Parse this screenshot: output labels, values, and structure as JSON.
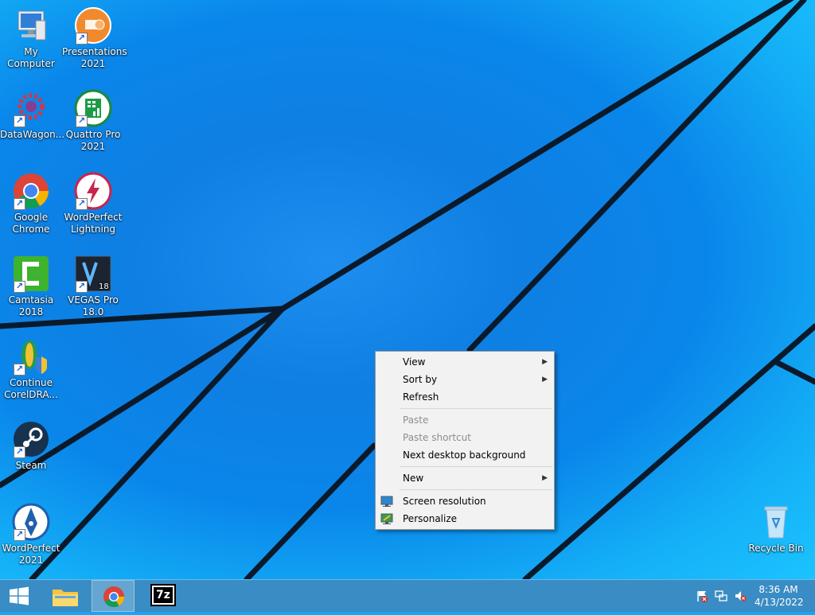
{
  "desktop": {
    "icons": [
      {
        "label": "My Computer",
        "icon": "computer-icon"
      },
      {
        "label": "Presentations 2021",
        "icon": "presentations-icon"
      },
      {
        "label": "DataWagon...",
        "icon": "datawagon-icon"
      },
      {
        "label": "Quattro Pro 2021",
        "icon": "quattro-pro-icon"
      },
      {
        "label": "Google Chrome",
        "icon": "chrome-icon"
      },
      {
        "label": "WordPerfect Lightning",
        "icon": "wordperfect-lightning-icon"
      },
      {
        "label": "Camtasia 2018",
        "icon": "camtasia-icon"
      },
      {
        "label": "VEGAS Pro 18.0",
        "icon": "vegas-pro-icon"
      },
      {
        "label": "Continue CorelDRA...",
        "icon": "coreldraw-icon"
      },
      {
        "label": "Steam",
        "icon": "steam-icon"
      },
      {
        "label": "WordPerfect 2021",
        "icon": "wordperfect-icon"
      },
      {
        "label": "Recycle Bin",
        "icon": "recycle-bin-icon"
      }
    ]
  },
  "context_menu": {
    "items": [
      {
        "label": "View",
        "submenu": true,
        "enabled": true
      },
      {
        "label": "Sort by",
        "submenu": true,
        "enabled": true
      },
      {
        "label": "Refresh",
        "submenu": false,
        "enabled": true
      },
      {
        "label": "Paste",
        "submenu": false,
        "enabled": false
      },
      {
        "label": "Paste shortcut",
        "submenu": false,
        "enabled": false
      },
      {
        "label": "Next desktop background",
        "submenu": false,
        "enabled": true
      },
      {
        "label": "New",
        "submenu": true,
        "enabled": true
      },
      {
        "label": "Screen resolution",
        "submenu": false,
        "enabled": true,
        "icon": "screen-resolution-icon"
      },
      {
        "label": "Personalize",
        "submenu": false,
        "enabled": true,
        "icon": "personalize-icon"
      }
    ]
  },
  "taskbar": {
    "start_icon": "windows-logo-icon",
    "pinned": [
      "file-explorer-icon",
      "chrome-icon",
      "7zip-icon"
    ],
    "active_index": 1,
    "pinned_7zip_text": "7z",
    "tray_icons": [
      "action-center-flag-icon",
      "network-icon",
      "volume-muted-icon"
    ],
    "time": "8:36 AM",
    "date": "4/13/2022"
  },
  "colors": {
    "wallpaper": "#1a9cf0",
    "taskbar": "#3a8cc4",
    "menu_bg": "#f2f2f2"
  }
}
